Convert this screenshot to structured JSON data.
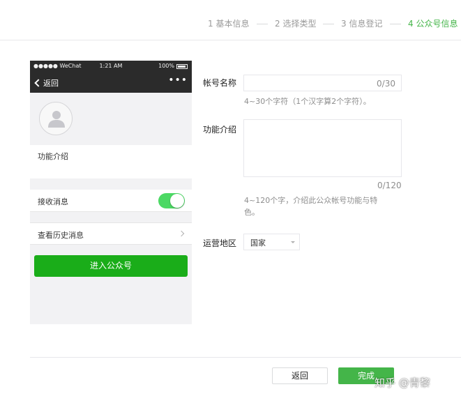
{
  "steps": [
    {
      "label": "1 基本信息",
      "active": false
    },
    {
      "label": "2 选择类型",
      "active": false
    },
    {
      "label": "3 信息登记",
      "active": false
    },
    {
      "label": "4 公众号信息",
      "active": true
    }
  ],
  "phone": {
    "status": {
      "carrier": "●●●●● WeChat",
      "time": "1:21 AM",
      "battery": "100%"
    },
    "nav": {
      "back_label": "返回",
      "more": "•••"
    },
    "intro_label": "功能介绍",
    "receive_label": "接收消息",
    "receive_on": true,
    "history_label": "查看历史消息",
    "follow_label": "进入公众号"
  },
  "form": {
    "name": {
      "label": "帐号名称",
      "value": "",
      "counter": "0/30",
      "hint": "4~30个字符（1个汉字算2个字符）。"
    },
    "intro": {
      "label": "功能介绍",
      "value": "",
      "counter": "0/120",
      "hint_line1": "4~120个字，介绍此公众帐号功能与特",
      "hint_line2": "色。"
    },
    "region": {
      "label": "运营地区",
      "value": "国家"
    }
  },
  "footer": {
    "back_label": "返回",
    "done_label": "完成"
  },
  "watermark": "知乎 @青黎",
  "colors": {
    "accent": "#44b549",
    "wechat_green": "#1aad19",
    "toggle_on": "#4cd964",
    "phone_bar": "#2b2b2b"
  }
}
